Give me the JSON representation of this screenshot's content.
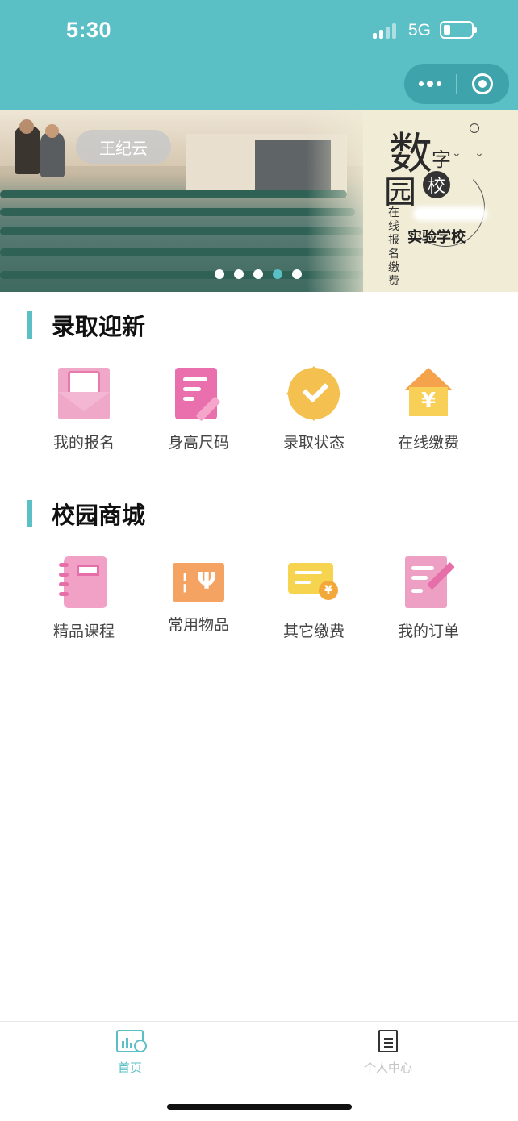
{
  "status_bar": {
    "time": "5:30",
    "network": "5G"
  },
  "banner": {
    "name_tag": "王纪云",
    "art_big_char_1": "数",
    "art_small_char": "字",
    "art_big_char_2": "园",
    "art_circle_char": "校",
    "art_vertical_text": "在线报名缴费",
    "art_school_name": "实验学校",
    "carousel_total": 5,
    "carousel_active_index": 3
  },
  "sections": [
    {
      "title": "录取迎新",
      "items": [
        {
          "label": "我的报名",
          "icon": "envelope-user-icon"
        },
        {
          "label": "身高尺码",
          "icon": "document-pen-icon"
        },
        {
          "label": "录取状态",
          "icon": "check-badge-icon"
        },
        {
          "label": "在线缴费",
          "icon": "house-yen-icon"
        }
      ]
    },
    {
      "title": "校园商城",
      "items": [
        {
          "label": "精品课程",
          "icon": "notebook-icon"
        },
        {
          "label": "常用物品",
          "icon": "cutlery-ticket-icon"
        },
        {
          "label": "其它缴费",
          "icon": "card-coin-icon"
        },
        {
          "label": "我的订单",
          "icon": "edit-list-icon"
        }
      ]
    }
  ],
  "tabbar": {
    "home_label": "首页",
    "profile_label": "个人中心"
  },
  "colors": {
    "accent": "#5bbfc6",
    "pink": "#ea70ad",
    "yellow": "#f4c04f",
    "orange": "#f4a362"
  }
}
